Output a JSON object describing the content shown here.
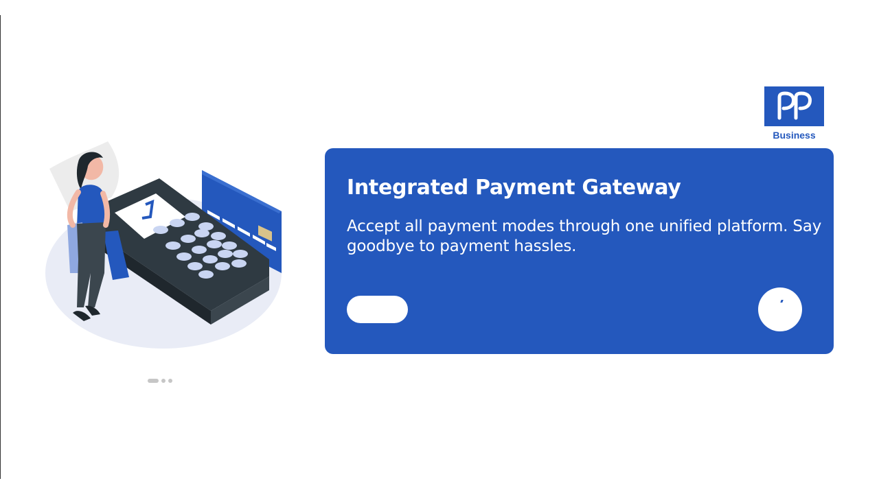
{
  "brand": {
    "logo_icon": "pp-logo-icon",
    "label": "Business",
    "color": "#2458bd"
  },
  "illustration": {
    "icon": "payment-terminal-shopper-illustration"
  },
  "carousel": {
    "total_slides": 3,
    "active_index": 0
  },
  "card": {
    "title": "Integrated Payment Gateway",
    "description": "Accept all payment modes through one unified platform. Say goodbye to payment hassles.",
    "background": "#2458bd",
    "primary_button_label": "",
    "next_button_icon": "arrow-right-icon"
  }
}
